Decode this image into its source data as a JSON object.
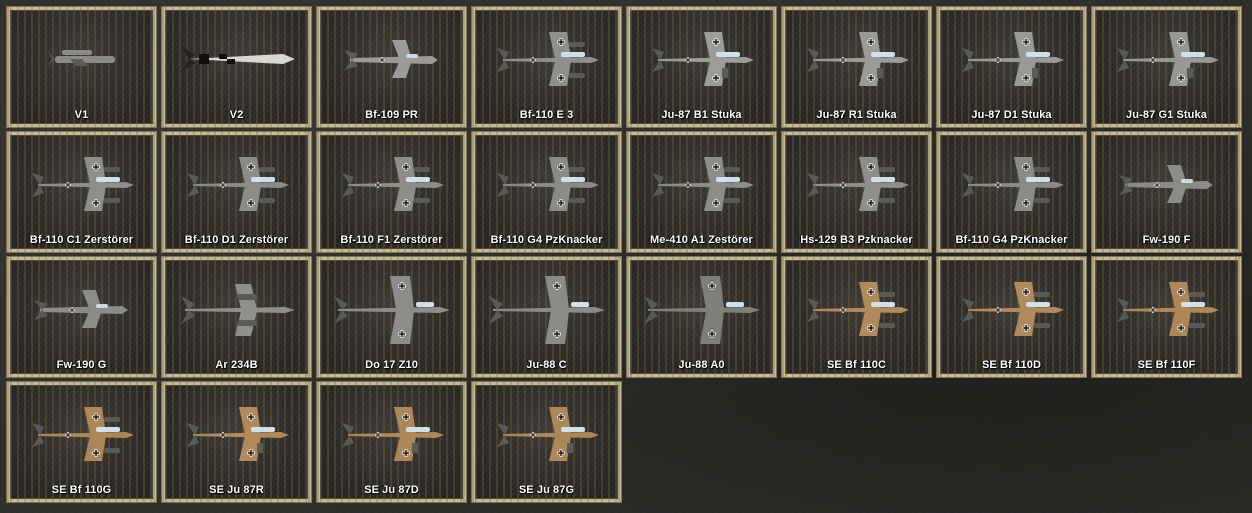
{
  "units": [
    {
      "name": "V1",
      "icon": "v1-flying-bomb-icon",
      "kind": "v1",
      "color": "#8c8a84"
    },
    {
      "name": "V2",
      "icon": "v2-rocket-icon",
      "kind": "v2",
      "color": "#d8d6d0"
    },
    {
      "name": "Bf-109 PR",
      "icon": "bf109-fighter-icon",
      "kind": "single",
      "color": "#9a9a96"
    },
    {
      "name": "Bf-110 E 3",
      "icon": "bf110-twin-engine-icon",
      "kind": "twin",
      "color": "#8f8f8b"
    },
    {
      "name": "Ju-87 B1 Stuka",
      "icon": "ju87-stuka-icon",
      "kind": "stuka",
      "color": "#9c9c98"
    },
    {
      "name": "Ju-87 R1 Stuka",
      "icon": "ju87-stuka-icon",
      "kind": "stuka",
      "color": "#9a9a96"
    },
    {
      "name": "Ju-87 D1 Stuka",
      "icon": "ju87-stuka-icon",
      "kind": "stuka",
      "color": "#999995"
    },
    {
      "name": "Ju-87 G1 Stuka",
      "icon": "ju87-stuka-icon",
      "kind": "stuka",
      "color": "#979793"
    },
    {
      "name": "Bf-110 C1 Zerstörer",
      "icon": "bf110-twin-engine-icon",
      "kind": "twin",
      "color": "#8e8e8a"
    },
    {
      "name": "Bf-110 D1 Zerstörer",
      "icon": "bf110-twin-engine-icon",
      "kind": "twin",
      "color": "#8b8b87"
    },
    {
      "name": "Bf-110 F1 Zerstörer",
      "icon": "bf110-twin-engine-icon",
      "kind": "twin",
      "color": "#8d8d89"
    },
    {
      "name": "Bf-110 G4 PzKnacker",
      "icon": "bf110-twin-engine-icon",
      "kind": "twin",
      "color": "#8a8a86"
    },
    {
      "name": "Me-410 A1 Zestörer",
      "icon": "me410-twin-engine-icon",
      "kind": "twin",
      "color": "#8c8c88"
    },
    {
      "name": "Hs-129 B3 Pzknacker",
      "icon": "hs129-ground-attack-icon",
      "kind": "twin",
      "color": "#8e8e8a"
    },
    {
      "name": "Bf-110 G4 PzKnacker",
      "icon": "bf110-twin-engine-icon",
      "kind": "twin",
      "color": "#8a8a86"
    },
    {
      "name": "Fw-190 F",
      "icon": "fw190-fighter-icon",
      "kind": "single",
      "color": "#8b8b87"
    },
    {
      "name": "Fw-190 G",
      "icon": "fw190-fighter-icon",
      "kind": "single",
      "color": "#8b8b87"
    },
    {
      "name": "Ar 234B",
      "icon": "ar234-jet-bomber-icon",
      "kind": "jet",
      "color": "#8f8f8b"
    },
    {
      "name": "Do 17 Z10",
      "icon": "do17-bomber-icon",
      "kind": "bomber",
      "color": "#8c8c88"
    },
    {
      "name": "Ju-88 C",
      "icon": "ju88-bomber-icon",
      "kind": "bomber",
      "color": "#8a8a86"
    },
    {
      "name": "Ju-88 A0",
      "icon": "ju88-bomber-icon",
      "kind": "bomber",
      "color": "#7e7e7a"
    },
    {
      "name": "SE Bf 110C",
      "icon": "bf110-desert-camo-icon",
      "kind": "twin",
      "color": "#b08a5a"
    },
    {
      "name": "SE Bf 110D",
      "icon": "bf110-desert-camo-icon",
      "kind": "twin",
      "color": "#b08a5a"
    },
    {
      "name": "SE Bf 110F",
      "icon": "bf110-desert-camo-icon",
      "kind": "twin",
      "color": "#ad8757"
    },
    {
      "name": "SE Bf 110G",
      "icon": "bf110-desert-camo-icon",
      "kind": "twin",
      "color": "#ad8757"
    },
    {
      "name": "SE Ju 87R",
      "icon": "ju87-desert-camo-icon",
      "kind": "stuka",
      "color": "#b08a5a"
    },
    {
      "name": "SE Ju 87D",
      "icon": "ju87-desert-camo-icon",
      "kind": "stuka",
      "color": "#ad8757"
    },
    {
      "name": "SE Ju 87G",
      "icon": "ju87-desert-camo-icon",
      "kind": "stuka",
      "color": "#ad8757"
    }
  ],
  "frame_color": "#c7bb95"
}
